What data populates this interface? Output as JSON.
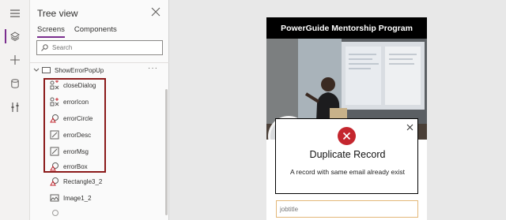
{
  "tree": {
    "title": "Tree view",
    "tabs": [
      {
        "label": "Screens",
        "active": true
      },
      {
        "label": "Components",
        "active": false
      }
    ],
    "search_placeholder": "Search",
    "screen": {
      "name": "ShowErrorPopUp",
      "more": "···"
    },
    "controls": [
      {
        "name": "closeDialog",
        "icon": "icon-control-icon"
      },
      {
        "name": "errorIcon",
        "icon": "icon-control-icon"
      },
      {
        "name": "errorCircle",
        "icon": "shape-icon"
      },
      {
        "name": "errorDesc",
        "icon": "label-edit-icon"
      },
      {
        "name": "errorMsg",
        "icon": "label-edit-icon"
      },
      {
        "name": "errorBox",
        "icon": "shape-icon"
      },
      {
        "name": "Rectangle3_2",
        "icon": "shape-icon"
      },
      {
        "name": "Image1_2",
        "icon": "image-icon"
      }
    ]
  },
  "rail": [
    "hamburger-icon",
    "layers-icon",
    "plus-icon",
    "database-icon",
    "tools-icon"
  ],
  "app": {
    "header": "PowerGuide Mentorship Program",
    "popup": {
      "title": "Duplicate Record",
      "message": "A record with same email already exist"
    },
    "jobtitle_placeholder": "jobtitle"
  },
  "colors": {
    "accent": "#7a2e8e",
    "highlight": "#8b1a1a",
    "error": "#c4262e"
  }
}
